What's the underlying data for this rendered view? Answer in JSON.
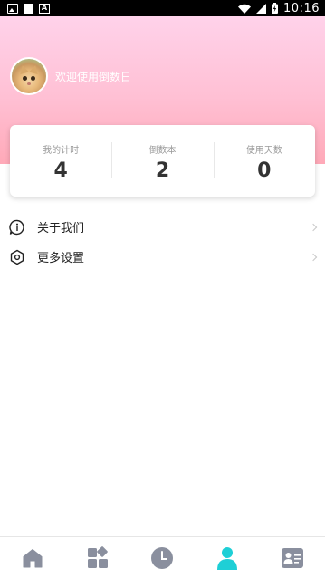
{
  "status_bar": {
    "time": "10:16",
    "icons": [
      "gallery-icon",
      "notification-icon",
      "a-icon",
      "wifi-icon",
      "signal-icon",
      "battery-charging-icon"
    ]
  },
  "profile": {
    "welcome_text": "欢迎使用倒数日"
  },
  "stats": [
    {
      "label": "我的计时",
      "value": "4"
    },
    {
      "label": "倒数本",
      "value": "2"
    },
    {
      "label": "使用天数",
      "value": "0"
    }
  ],
  "menu": {
    "items": [
      {
        "label": "关于我们",
        "icon": "info-icon"
      },
      {
        "label": "更多设置",
        "icon": "settings-icon"
      }
    ]
  },
  "bottom_nav": {
    "items": [
      {
        "icon": "home-icon",
        "active": false
      },
      {
        "icon": "apps-icon",
        "active": false
      },
      {
        "icon": "clock-icon",
        "active": false
      },
      {
        "icon": "profile-icon",
        "active": true
      },
      {
        "icon": "id-card-icon",
        "active": false
      }
    ],
    "active_color": "#1ecfd6",
    "inactive_color": "#8a8f9e"
  },
  "colors": {
    "hero_top": "#ffd2ea",
    "hero_bottom": "#ffa9b8"
  }
}
